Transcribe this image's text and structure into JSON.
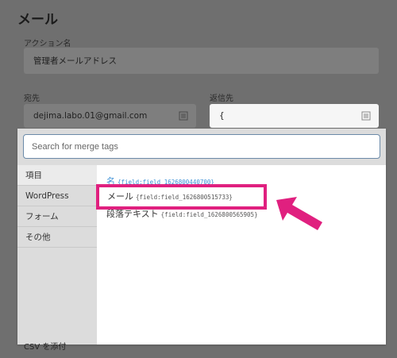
{
  "form": {
    "title": "メール",
    "action_name_label": "アクション名",
    "action_name_value": "管理者メールアドレス",
    "to_label": "宛先",
    "to_value": "dejima.labo.01@gmail.com",
    "reply_label": "返信先",
    "reply_value": "{",
    "csv_label": "CSV を添付"
  },
  "merge_popup": {
    "search_placeholder": "Search for merge tags",
    "sidebar": [
      "項目",
      "WordPress",
      "フォーム",
      "その他"
    ],
    "tags": [
      {
        "name": "名",
        "code": "{field:field_1626800440700}"
      },
      {
        "name": "メール",
        "code": "{field:field_1626800515733}"
      },
      {
        "name": "段落テキスト",
        "code": "{field:field_1626800565905}"
      }
    ]
  },
  "colors": {
    "highlight": "#e0207f",
    "search_border": "#6b8aa8",
    "link_blue": "#3a8fd6"
  },
  "icons": {
    "to_field": "merge-tag-icon",
    "reply_field": "merge-tag-icon",
    "annotation": "pointer-arrow-icon"
  }
}
